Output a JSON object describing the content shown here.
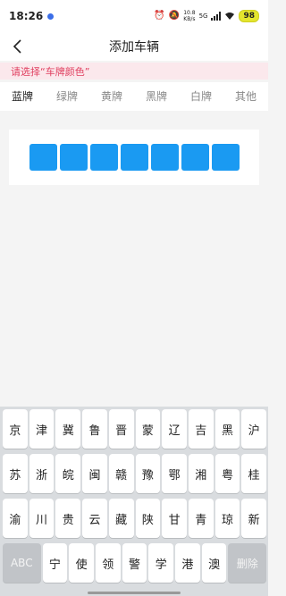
{
  "status_bar": {
    "time": "18:26",
    "speed_top": "10.8",
    "speed_bottom": "KB/s",
    "network": "5G",
    "battery": "98"
  },
  "header": {
    "title": "添加车辆",
    "back_icon": "chevron-left-icon"
  },
  "warning": {
    "text": "请选择“车牌颜色”",
    "color": "#e04060"
  },
  "tabs": [
    {
      "label": "蓝牌"
    },
    {
      "label": "绿牌"
    },
    {
      "label": "黄牌"
    },
    {
      "label": "黑牌"
    },
    {
      "label": "白牌"
    },
    {
      "label": "其他"
    }
  ],
  "plate": {
    "box_color": "#1a9af2",
    "chars": [
      "",
      "",
      "",
      "",
      "",
      "",
      ""
    ]
  },
  "keyboard": {
    "row1": [
      "京",
      "津",
      "冀",
      "鲁",
      "晋",
      "蒙",
      "辽",
      "吉",
      "黑",
      "沪"
    ],
    "row2": [
      "苏",
      "浙",
      "皖",
      "闽",
      "赣",
      "豫",
      "鄂",
      "湘",
      "粤",
      "桂"
    ],
    "row3": [
      "渝",
      "川",
      "贵",
      "云",
      "藏",
      "陕",
      "甘",
      "青",
      "琼",
      "新"
    ],
    "abc_label": "ABC",
    "row4": [
      "宁",
      "使",
      "领",
      "警",
      "学",
      "港",
      "澳"
    ],
    "delete_label": "删除"
  }
}
